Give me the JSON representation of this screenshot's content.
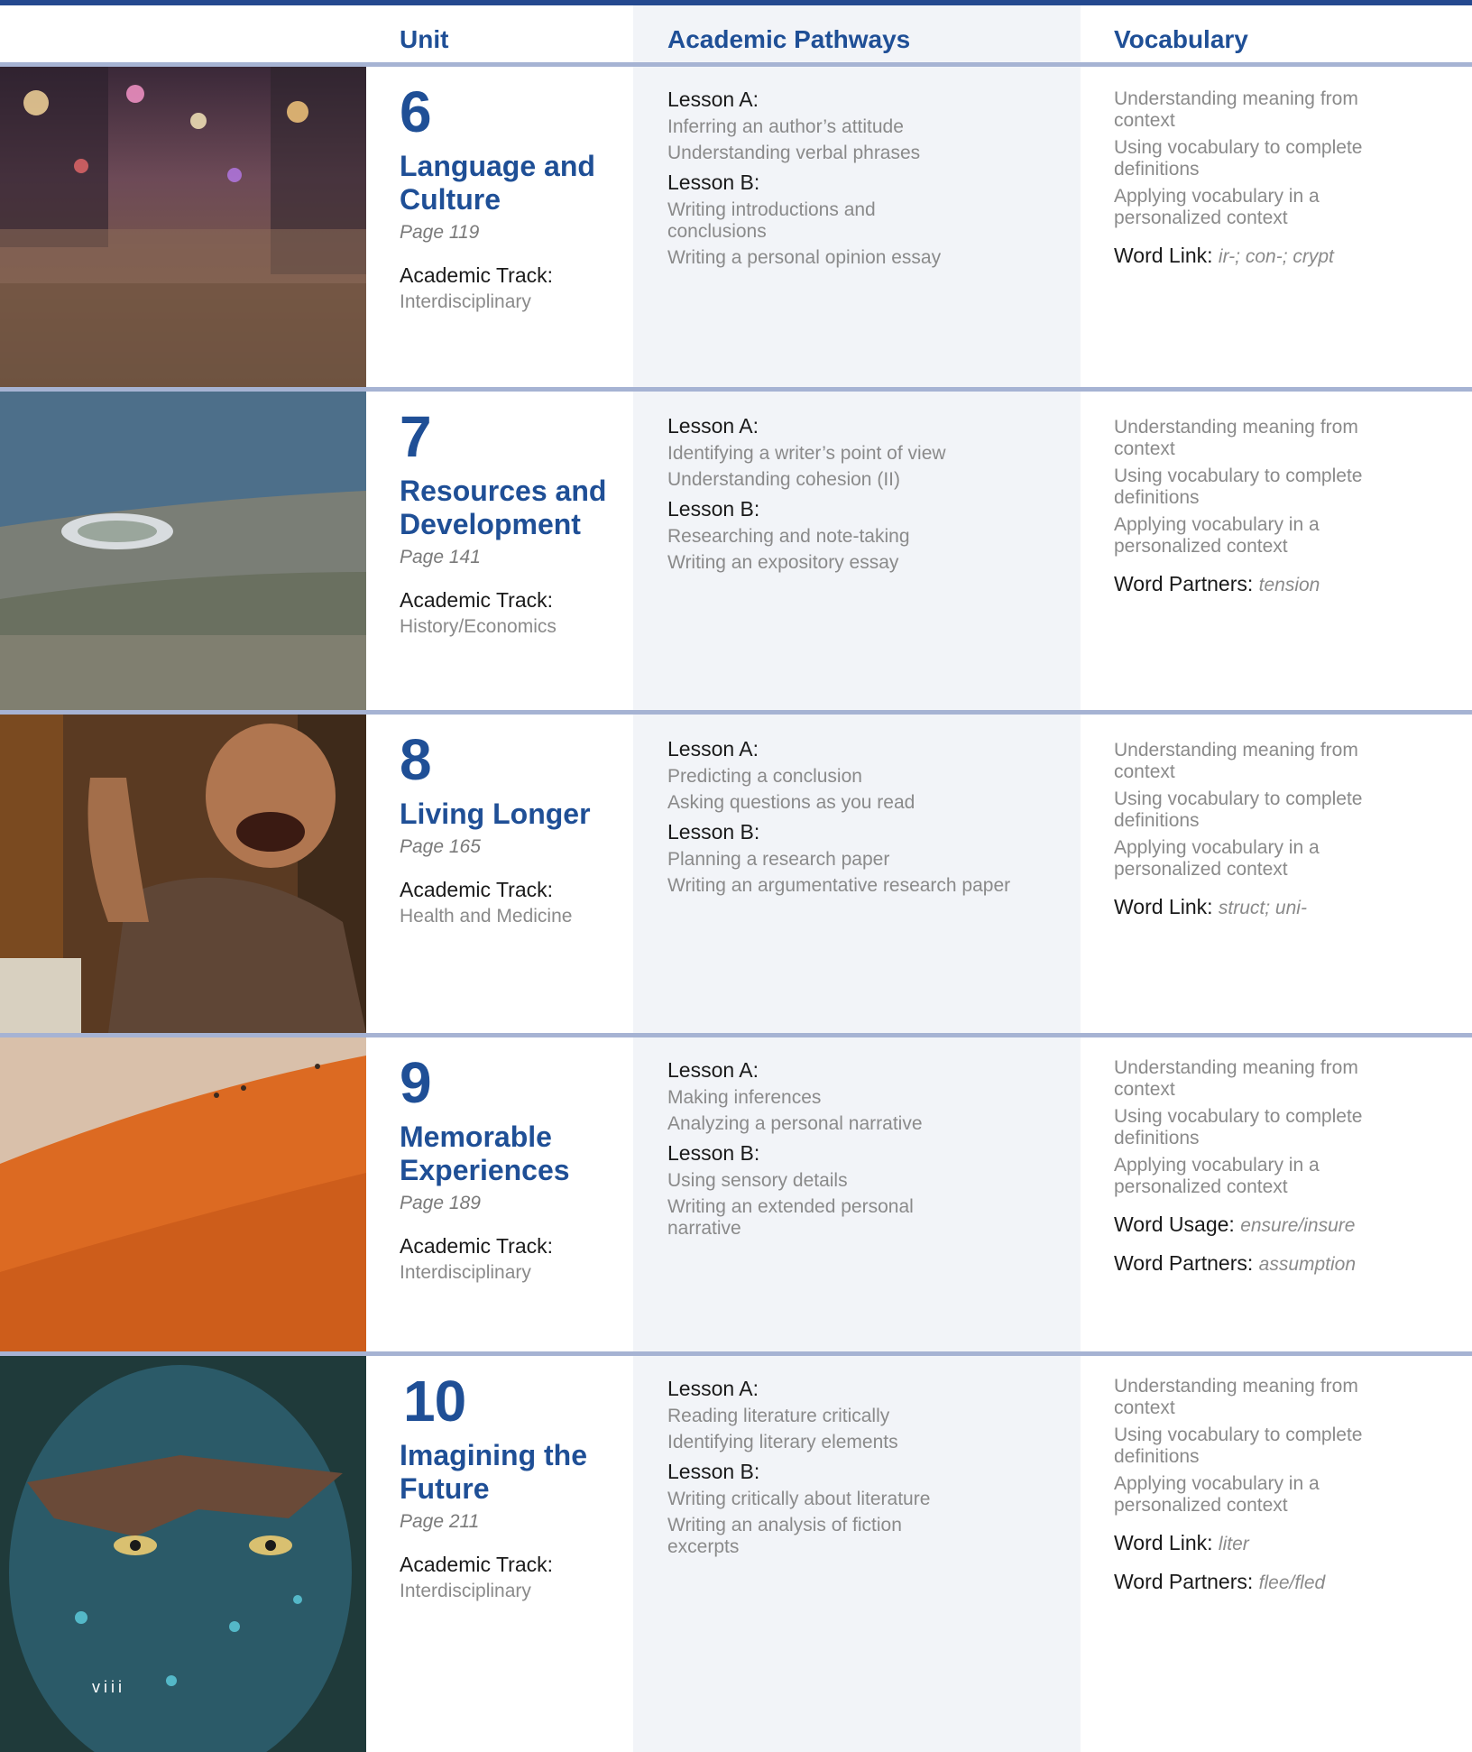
{
  "header": {
    "unit": "Unit",
    "pathways": "Academic Pathways",
    "vocabulary": "Vocabulary"
  },
  "units": [
    {
      "number": "6",
      "title": "Language and Culture",
      "page": "Page 119",
      "track_label": "Academic Track:",
      "track": "Interdisciplinary",
      "lesson_a_label": "Lesson A:",
      "lesson_a": [
        "Inferring an author’s attitude",
        "Understanding verbal phrases"
      ],
      "lesson_b_label": "Lesson B:",
      "lesson_b": [
        "Writing introductions and conclusions",
        "Writing a personal opinion essay"
      ],
      "vocab": [
        "Understanding meaning from context",
        "Using vocabulary to complete definitions",
        "Applying vocabulary in a personalized context"
      ],
      "extras": [
        {
          "label": "Word Link:",
          "value": "ir-; con-; crypt"
        }
      ],
      "photo": "night-street-crowd"
    },
    {
      "number": "7",
      "title": "Resources and Development",
      "page": "Page 141",
      "track_label": "Academic Track:",
      "track": "History/Economics",
      "lesson_a_label": "Lesson A:",
      "lesson_a": [
        "Identifying a writer’s point of view",
        "Understanding cohesion (II)"
      ],
      "lesson_b_label": "Lesson B:",
      "lesson_b": [
        "Researching and note-taking",
        "Writing an expository essay"
      ],
      "vocab": [
        "Understanding meaning from context",
        "Using vocabulary to complete definitions",
        "Applying vocabulary in a personalized context"
      ],
      "extras": [
        {
          "label": "Word Partners:",
          "value": "tension"
        }
      ],
      "photo": "coastal-city-stadium"
    },
    {
      "number": "8",
      "title": "Living Longer",
      "page": "Page 165",
      "track_label": "Academic Track:",
      "track": "Health and Medicine",
      "lesson_a_label": "Lesson A:",
      "lesson_a": [
        "Predicting a conclusion",
        "Asking questions as you read"
      ],
      "lesson_b_label": "Lesson B:",
      "lesson_b": [
        "Planning a research paper",
        "Writing an argumentative research paper"
      ],
      "vocab": [
        "Understanding meaning from context",
        "Using vocabulary to complete definitions",
        "Applying vocabulary in a personalized context"
      ],
      "extras": [
        {
          "label": "Word Link:",
          "value": "struct; uni-"
        }
      ],
      "photo": "laughing-elderly-man"
    },
    {
      "number": "9",
      "title": "Memorable Experiences",
      "page": "Page 189",
      "track_label": "Academic Track:",
      "track": "Interdisciplinary",
      "lesson_a_label": "Lesson A:",
      "lesson_a": [
        "Making inferences",
        "Analyzing a personal narrative"
      ],
      "lesson_b_label": "Lesson B:",
      "lesson_b": [
        "Using sensory details",
        "Writing an extended personal narrative"
      ],
      "vocab": [
        "Understanding meaning from context",
        "Using vocabulary to complete definitions",
        "Applying vocabulary in a personalized context"
      ],
      "extras": [
        {
          "label": "Word Usage:",
          "value": "ensure/insure"
        },
        {
          "label": "Word Partners:",
          "value": "assumption"
        }
      ],
      "photo": "desert-dune"
    },
    {
      "number": "10",
      "title": "Imagining the Future",
      "page": "Page 211",
      "track_label": "Academic Track:",
      "track": "Interdisciplinary",
      "lesson_a_label": "Lesson A:",
      "lesson_a": [
        "Reading literature critically",
        "Identifying literary elements"
      ],
      "lesson_b_label": "Lesson B:",
      "lesson_b": [
        "Writing critically about literature",
        "Writing an analysis of fiction excerpts"
      ],
      "vocab": [
        "Understanding meaning from context",
        "Using vocabulary to complete definitions",
        "Applying vocabulary in a personalized context"
      ],
      "extras": [
        {
          "label": "Word Link:",
          "value": "liter"
        },
        {
          "label": "Word Partners:",
          "value": "flee/fled"
        }
      ],
      "photo": "blue-painted-face"
    }
  ],
  "page_number": "viii"
}
